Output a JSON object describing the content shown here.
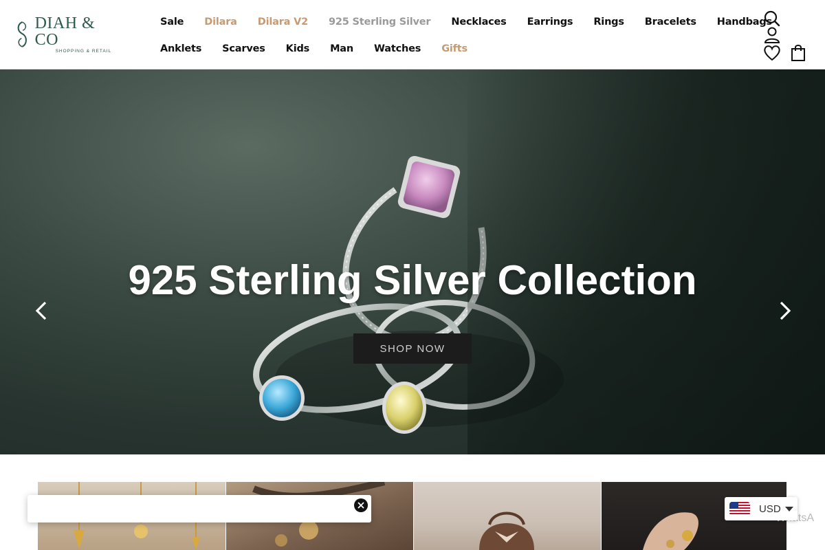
{
  "brand": {
    "name": "DIAH & CO",
    "tagline": "SHOPPING & RETAIL",
    "color": "#2f5a4e"
  },
  "nav": {
    "row1": [
      {
        "label": "Sale",
        "style": "default"
      },
      {
        "label": "Dilara",
        "style": "accent"
      },
      {
        "label": "Dilara V2",
        "style": "accent"
      },
      {
        "label": "925 Sterling Silver",
        "style": "muted"
      },
      {
        "label": "Necklaces",
        "style": "default"
      },
      {
        "label": "Earrings",
        "style": "default"
      },
      {
        "label": "Rings",
        "style": "default"
      },
      {
        "label": "Bracelets",
        "style": "default"
      },
      {
        "label": "Handbags",
        "style": "default"
      }
    ],
    "row2": [
      {
        "label": "Anklets",
        "style": "default"
      },
      {
        "label": "Scarves",
        "style": "default"
      },
      {
        "label": "Kids",
        "style": "default"
      },
      {
        "label": "Man",
        "style": "default"
      },
      {
        "label": "Watches",
        "style": "default"
      },
      {
        "label": "Gifts",
        "style": "accent"
      }
    ],
    "accent_color": "#c89a72",
    "muted_color": "#9a9a9a"
  },
  "header_icons": [
    "search-icon",
    "account-icon",
    "wishlist-heart-icon",
    "cart-bag-icon"
  ],
  "hero": {
    "title": "925 Sterling Silver Collection",
    "cta_label": "SHOP NOW",
    "prev_icon": "chevron-left-icon",
    "next_icon": "chevron-right-icon"
  },
  "categories": {
    "tiles": [
      "gold-pendants-tile",
      "charms-tile",
      "handbag-tile",
      "rings-hand-tile"
    ]
  },
  "popup": {
    "close_icon": "close-icon"
  },
  "currency": {
    "code": "USD",
    "flag": "us-flag-icon"
  },
  "whatsapp": {
    "label": "WhatsA"
  }
}
